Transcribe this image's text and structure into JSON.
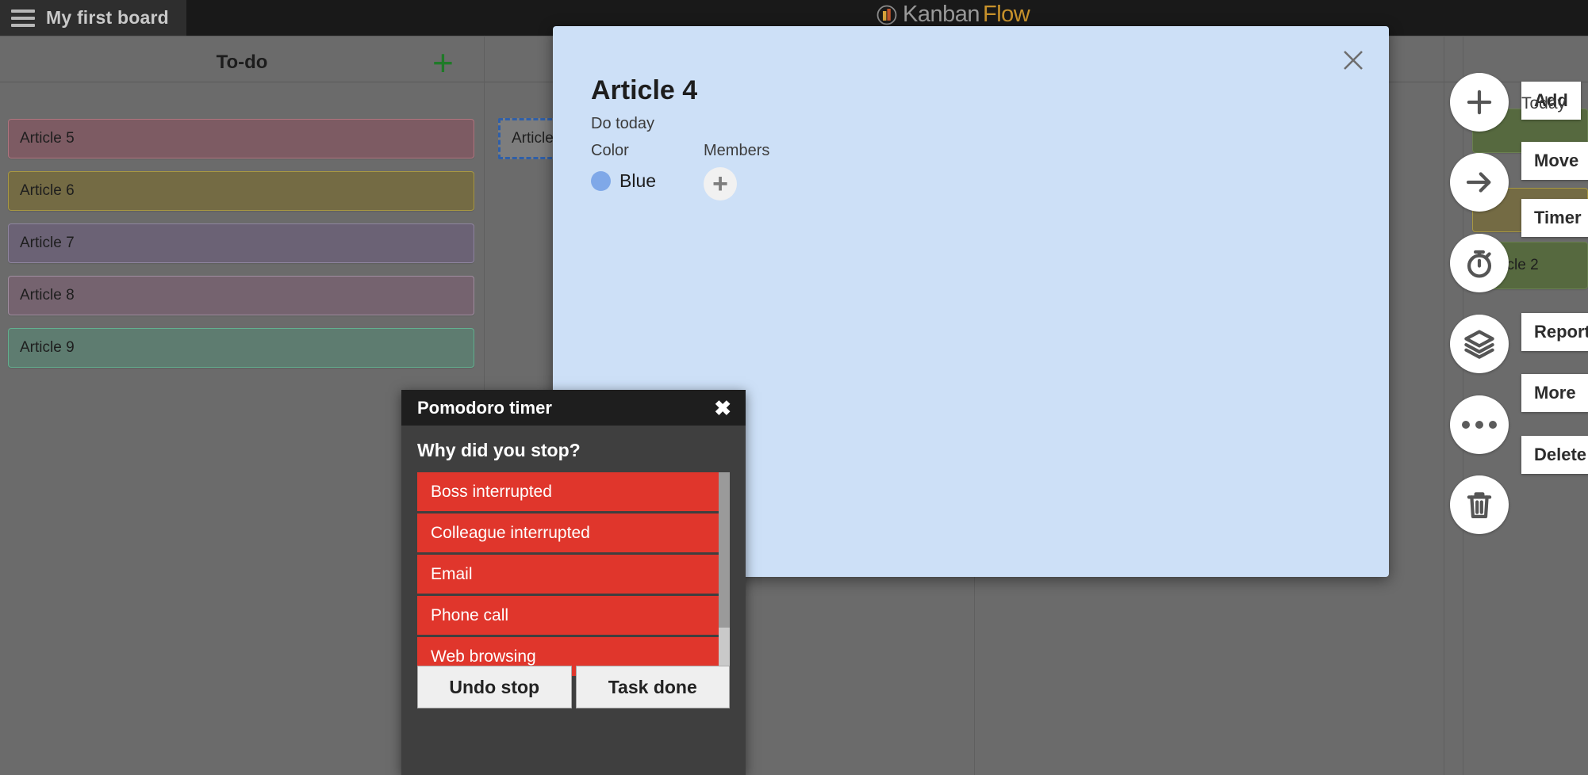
{
  "topbar": {
    "menu_icon": "hamburger-icon",
    "board_title": "My first board",
    "logo_primary": "Kanban",
    "logo_secondary": "Flow"
  },
  "board": {
    "columns": [
      {
        "title": "To-do",
        "add_label": "+"
      },
      {
        "title": "",
        "add_label": ""
      },
      {
        "title": "",
        "add_label": ""
      },
      {
        "title": "",
        "add_label": ""
      }
    ],
    "todo_cards": [
      {
        "label": "Article 5",
        "bg": "#7d5b63",
        "border": "#b0757f"
      },
      {
        "label": "Article 6",
        "bg": "#746b44",
        "border": "#a89842"
      },
      {
        "label": "Article 7",
        "bg": "#6b6275",
        "border": "#8f85a0"
      },
      {
        "label": "Article 8",
        "bg": "#75636f",
        "border": "#a08ea0"
      },
      {
        "label": "Article 9",
        "bg": "#5e7c70",
        "border": "#62b08f"
      }
    ],
    "ghost_card": {
      "label": "Article"
    },
    "right_cards": [
      {
        "label": "",
        "bg": "#56693f",
        "border": "#6a8050"
      },
      {
        "label": "",
        "bg": "#746b44",
        "border": "#a89842"
      },
      {
        "label": "Article 2",
        "bg": "#56693f",
        "border": "#6a8050"
      }
    ]
  },
  "rail": {
    "today_label": "Today",
    "actions": [
      {
        "label": "Add",
        "icon": "plus-icon"
      },
      {
        "label": "Move",
        "icon": "arrow-right-icon"
      },
      {
        "label": "Timer",
        "icon": "stopwatch-icon"
      },
      {
        "label": "Reports",
        "icon": "layers-icon"
      },
      {
        "label": "More",
        "icon": "ellipsis-icon"
      },
      {
        "label": "Delete",
        "icon": "trash-icon"
      }
    ]
  },
  "task_modal": {
    "title": "Article 4",
    "subtitle": "Do today",
    "close_icon": "close-icon",
    "color_label": "Color",
    "color_value": "Blue",
    "color_hex": "#7fa8e8",
    "members_label": "Members",
    "member_add_icon": "plus-icon"
  },
  "pomodoro": {
    "window_title": "Pomodoro timer",
    "close_icon": "close-icon",
    "question": "Why did you stop?",
    "reasons": [
      "Boss interrupted",
      "Colleague interrupted",
      "Email",
      "Phone call",
      "Web browsing"
    ],
    "reason_color": "#e0362c",
    "buttons": {
      "undo": "Undo stop",
      "done": "Task done"
    }
  }
}
